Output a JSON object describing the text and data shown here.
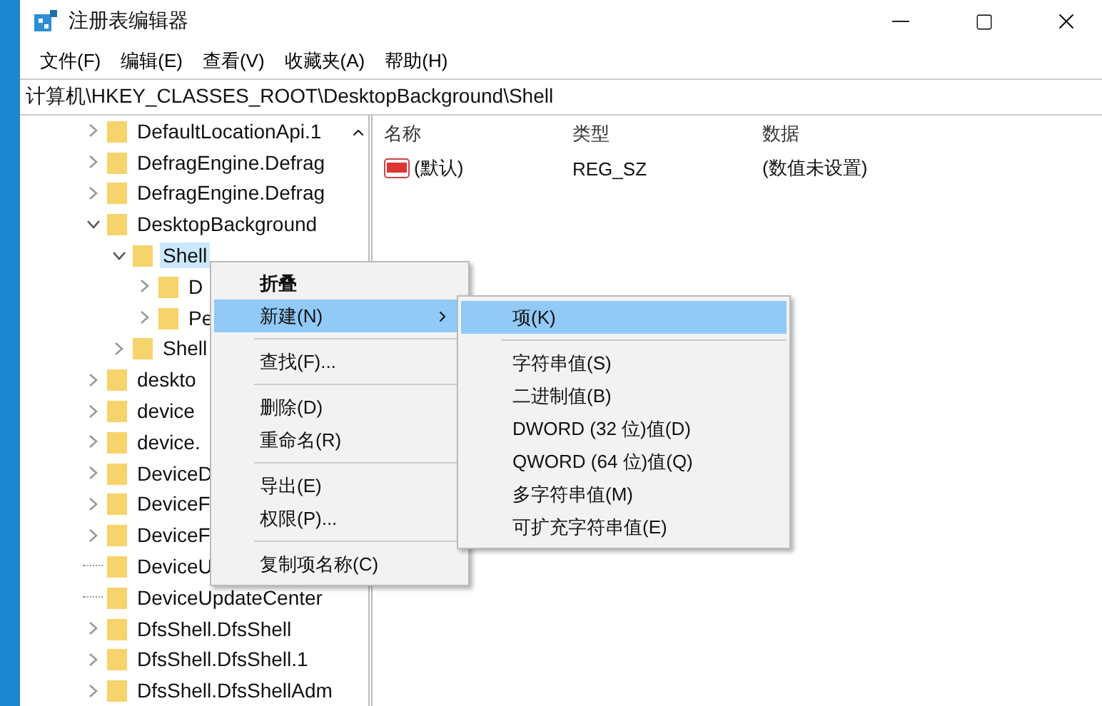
{
  "window": {
    "title": "注册表编辑器"
  },
  "menu_bar": [
    {
      "label": "文件(F)"
    },
    {
      "label": "编辑(E)"
    },
    {
      "label": "查看(V)"
    },
    {
      "label": "收藏夹(A)"
    },
    {
      "label": "帮助(H)"
    }
  ],
  "address": "计算机\\HKEY_CLASSES_ROOT\\DesktopBackground\\Shell",
  "tree": [
    {
      "label": "DefaultLocationApi.1",
      "kind": "folder",
      "expanded": false,
      "selected": false
    },
    {
      "label": "DefragEngine.Defrag",
      "kind": "folder",
      "expanded": false,
      "selected": false
    },
    {
      "label": "DefragEngine.Defrag",
      "kind": "folder",
      "expanded": false,
      "selected": false
    },
    {
      "label": "DesktopBackground",
      "kind": "folder",
      "expanded": true,
      "selected": false,
      "children": [
        {
          "label": "Shell",
          "kind": "folder",
          "expanded": true,
          "selected": true,
          "children": [
            {
              "label": "D",
              "kind": "folder",
              "expanded": false,
              "selected": false
            },
            {
              "label": "Pe",
              "kind": "folder",
              "expanded": false,
              "selected": false
            }
          ]
        },
        {
          "label": "Shell",
          "kind": "folder",
          "expanded": false,
          "selected": false
        }
      ]
    },
    {
      "label": "deskto",
      "kind": "folder",
      "expanded": false,
      "selected": false
    },
    {
      "label": "device",
      "kind": "folder",
      "expanded": false,
      "selected": false
    },
    {
      "label": "device.",
      "kind": "folder",
      "expanded": false,
      "selected": false
    },
    {
      "label": "DeviceD",
      "kind": "folder",
      "expanded": false,
      "selected": false
    },
    {
      "label": "DeviceF",
      "kind": "folder",
      "expanded": false,
      "selected": false
    },
    {
      "label": "DeviceF",
      "kind": "folder",
      "expanded": false,
      "selected": false
    },
    {
      "label": "DeviceU",
      "kind": "leaf",
      "selected": false
    },
    {
      "label": "DeviceUpdateCenter",
      "kind": "leaf",
      "selected": false
    },
    {
      "label": "DfsShell.DfsShell",
      "kind": "folder",
      "expanded": false,
      "selected": false
    },
    {
      "label": "DfsShell.DfsShell.1",
      "kind": "folder",
      "expanded": false,
      "selected": false
    },
    {
      "label": "DfsShell.DfsShellAdm",
      "kind": "folder",
      "expanded": false,
      "selected": false
    }
  ],
  "table": {
    "columns": [
      "名称",
      "类型",
      "数据"
    ],
    "rows": [
      {
        "name": "(默认)",
        "type": "REG_SZ",
        "data": "(数值未设置)"
      }
    ]
  },
  "context_menu": {
    "items": [
      {
        "kind": "item",
        "label": "折叠",
        "bold": true,
        "selected": false,
        "submenu": false
      },
      {
        "kind": "item",
        "label": "新建(N)",
        "bold": false,
        "selected": true,
        "submenu": true
      },
      {
        "kind": "separator"
      },
      {
        "kind": "item",
        "label": "查找(F)...",
        "bold": false,
        "selected": false,
        "submenu": false
      },
      {
        "kind": "separator"
      },
      {
        "kind": "item",
        "label": "删除(D)",
        "bold": false,
        "selected": false,
        "submenu": false
      },
      {
        "kind": "item",
        "label": "重命名(R)",
        "bold": false,
        "selected": false,
        "submenu": false
      },
      {
        "kind": "separator"
      },
      {
        "kind": "item",
        "label": "导出(E)",
        "bold": false,
        "selected": false,
        "submenu": false
      },
      {
        "kind": "item",
        "label": "权限(P)...",
        "bold": false,
        "selected": false,
        "submenu": false
      },
      {
        "kind": "separator"
      },
      {
        "kind": "item",
        "label": "复制项名称(C)",
        "bold": false,
        "selected": false,
        "submenu": false
      }
    ]
  },
  "submenu": {
    "items": [
      {
        "kind": "item",
        "label": "项(K)",
        "selected": true
      },
      {
        "kind": "separator"
      },
      {
        "kind": "item",
        "label": "字符串值(S)",
        "selected": false
      },
      {
        "kind": "item",
        "label": "二进制值(B)",
        "selected": false
      },
      {
        "kind": "item",
        "label": "DWORD (32 位)值(D)",
        "selected": false
      },
      {
        "kind": "item",
        "label": "QWORD (64 位)值(Q)",
        "selected": false
      },
      {
        "kind": "item",
        "label": "多字符串值(M)",
        "selected": false
      },
      {
        "kind": "item",
        "label": "可扩充字符串值(E)",
        "selected": false
      }
    ]
  }
}
